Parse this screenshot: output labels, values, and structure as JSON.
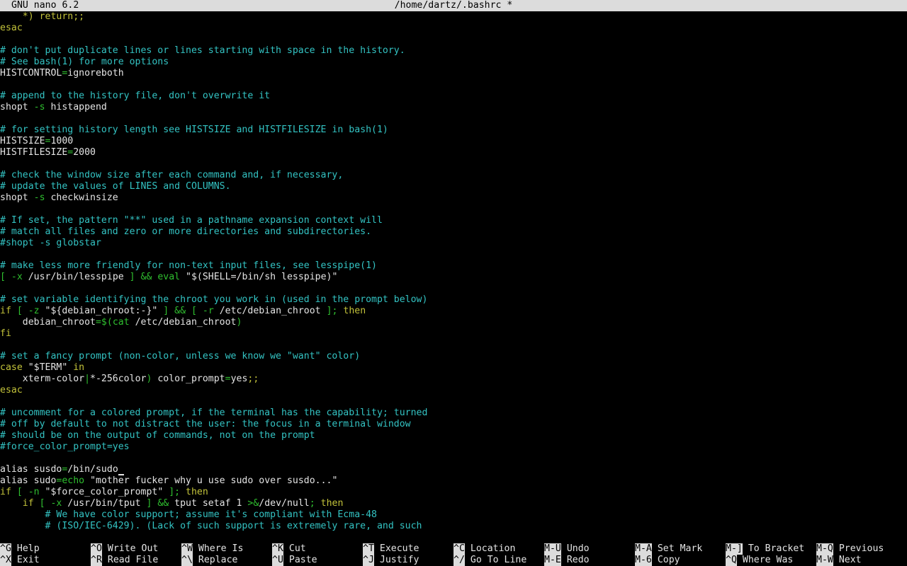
{
  "titlebar": {
    "app": "GNU nano 6.2",
    "filename": "/home/dartz/.bashrc *"
  },
  "colors": {
    "titlebar_bg": "#dcdcdc",
    "comment": "#33c3c3",
    "keyword": "#c2c23a",
    "operator": "#2fbf2f",
    "text": "#e4e4e4"
  },
  "lines": [
    [
      {
        "t": "    *) return;;",
        "c": "kw"
      }
    ],
    [
      {
        "t": "esac",
        "c": "kw"
      }
    ],
    [],
    [
      {
        "t": "# don't put duplicate lines or lines starting with space in the history.",
        "c": "cm"
      }
    ],
    [
      {
        "t": "# See bash(1) for more options",
        "c": "cm"
      }
    ],
    [
      {
        "t": "HISTCONTROL",
        "c": "var"
      },
      {
        "t": "=",
        "c": "op"
      },
      {
        "t": "ignoreboth",
        "c": "var"
      }
    ],
    [],
    [
      {
        "t": "# append to the history file, don't overwrite it",
        "c": "cm"
      }
    ],
    [
      {
        "t": "shopt ",
        "c": "var"
      },
      {
        "t": "-s",
        "c": "op"
      },
      {
        "t": " histappend",
        "c": "var"
      }
    ],
    [],
    [
      {
        "t": "# for setting history length see HISTSIZE and HISTFILESIZE in bash(1)",
        "c": "cm"
      }
    ],
    [
      {
        "t": "HISTSIZE",
        "c": "var"
      },
      {
        "t": "=",
        "c": "op"
      },
      {
        "t": "1000",
        "c": "var"
      }
    ],
    [
      {
        "t": "HISTFILESIZE",
        "c": "var"
      },
      {
        "t": "=",
        "c": "op"
      },
      {
        "t": "2000",
        "c": "var"
      }
    ],
    [],
    [
      {
        "t": "# check the window size after each command and, if necessary,",
        "c": "cm"
      }
    ],
    [
      {
        "t": "# update the values of LINES and COLUMNS.",
        "c": "cm"
      }
    ],
    [
      {
        "t": "shopt ",
        "c": "var"
      },
      {
        "t": "-s",
        "c": "op"
      },
      {
        "t": " checkwinsize",
        "c": "var"
      }
    ],
    [],
    [
      {
        "t": "# If set, the pattern \"**\" used in a pathname expansion context will",
        "c": "cm"
      }
    ],
    [
      {
        "t": "# match all files and zero or more directories and subdirectories.",
        "c": "cm"
      }
    ],
    [
      {
        "t": "#shopt -s globstar",
        "c": "cm"
      }
    ],
    [],
    [
      {
        "t": "# make less more friendly for non-text input files, see lesspipe(1)",
        "c": "cm"
      }
    ],
    [
      {
        "t": "[ ",
        "c": "op"
      },
      {
        "t": "-x",
        "c": "op"
      },
      {
        "t": " /usr/bin/lesspipe ",
        "c": "var"
      },
      {
        "t": "] && ",
        "c": "op"
      },
      {
        "t": "eval",
        "c": "op"
      },
      {
        "t": " \"$(SHELL=/bin/sh lesspipe)\"",
        "c": "str"
      }
    ],
    [],
    [
      {
        "t": "# set variable identifying the chroot you work in (used in the prompt below)",
        "c": "cm"
      }
    ],
    [
      {
        "t": "if",
        "c": "kw"
      },
      {
        "t": " [ ",
        "c": "op"
      },
      {
        "t": "-z",
        "c": "op"
      },
      {
        "t": " \"${debian_chroot:-}\"",
        "c": "str"
      },
      {
        "t": " ] && [ ",
        "c": "op"
      },
      {
        "t": "-r",
        "c": "op"
      },
      {
        "t": " /etc/debian_chroot ",
        "c": "var"
      },
      {
        "t": "]; ",
        "c": "op"
      },
      {
        "t": "then",
        "c": "kw"
      }
    ],
    [
      {
        "t": "    debian_chroot",
        "c": "var"
      },
      {
        "t": "=$(",
        "c": "op"
      },
      {
        "t": "cat",
        "c": "op"
      },
      {
        "t": " /etc/debian_chroot",
        "c": "var"
      },
      {
        "t": ")",
        "c": "op"
      }
    ],
    [
      {
        "t": "fi",
        "c": "kw"
      }
    ],
    [],
    [
      {
        "t": "# set a fancy prompt (non-color, unless we know we \"want\" color)",
        "c": "cm"
      }
    ],
    [
      {
        "t": "case",
        "c": "kw"
      },
      {
        "t": " \"$TERM\"",
        "c": "str"
      },
      {
        "t": " in",
        "c": "kw"
      }
    ],
    [
      {
        "t": "    xterm-color",
        "c": "var"
      },
      {
        "t": "|",
        "c": "op"
      },
      {
        "t": "*-256color",
        "c": "var"
      },
      {
        "t": ")",
        "c": "op"
      },
      {
        "t": " color_prompt",
        "c": "var"
      },
      {
        "t": "=",
        "c": "op"
      },
      {
        "t": "yes",
        "c": "var"
      },
      {
        "t": ";;",
        "c": "kw"
      }
    ],
    [
      {
        "t": "esac",
        "c": "kw"
      }
    ],
    [],
    [
      {
        "t": "# uncomment for a colored prompt, if the terminal has the capability; turned",
        "c": "cm"
      }
    ],
    [
      {
        "t": "# off by default to not distract the user: the focus in a terminal window",
        "c": "cm"
      }
    ],
    [
      {
        "t": "# should be on the output of commands, not on the prompt",
        "c": "cm"
      }
    ],
    [
      {
        "t": "#force_color_prompt=yes",
        "c": "cm"
      }
    ],
    [],
    [
      {
        "t": "alias susdo",
        "c": "var"
      },
      {
        "t": "=",
        "c": "op"
      },
      {
        "t": "/bin/sudo",
        "c": "var"
      }
    ],
    [
      {
        "t": "alias sudo",
        "c": "var"
      },
      {
        "t": "=",
        "c": "op"
      },
      {
        "t": "echo",
        "c": "op"
      },
      {
        "t": " \"mother fucker why u use sudo over susdo...\"",
        "c": "str"
      }
    ],
    [
      {
        "t": "if",
        "c": "kw"
      },
      {
        "t": " [ ",
        "c": "op"
      },
      {
        "t": "-n",
        "c": "op"
      },
      {
        "t": " \"$force_color_prompt\"",
        "c": "str"
      },
      {
        "t": " ]; ",
        "c": "op"
      },
      {
        "t": "then",
        "c": "kw"
      }
    ],
    [
      {
        "t": "    if",
        "c": "kw"
      },
      {
        "t": " [ ",
        "c": "op"
      },
      {
        "t": "-x",
        "c": "op"
      },
      {
        "t": " /usr/bin/tput ",
        "c": "var"
      },
      {
        "t": "] && ",
        "c": "op"
      },
      {
        "t": "tput setaf 1 ",
        "c": "var"
      },
      {
        "t": ">&",
        "c": "op"
      },
      {
        "t": "/dev/null",
        "c": "var"
      },
      {
        "t": "; ",
        "c": "op"
      },
      {
        "t": "then",
        "c": "kw"
      }
    ],
    [
      {
        "t": "        # We have color support; assume it's compliant with Ecma-48",
        "c": "cm"
      }
    ],
    [
      {
        "t": "        # (ISO/IEC-6429). (Lack of such support is extremely rare, and such",
        "c": "cm"
      }
    ]
  ],
  "shortcuts": [
    {
      "key": "^G",
      "label": "Help"
    },
    {
      "key": "^X",
      "label": "Exit"
    },
    {
      "key": "^O",
      "label": "Write Out"
    },
    {
      "key": "^R",
      "label": "Read File"
    },
    {
      "key": "^W",
      "label": "Where Is"
    },
    {
      "key": "^\\",
      "label": "Replace"
    },
    {
      "key": "^K",
      "label": "Cut"
    },
    {
      "key": "^U",
      "label": "Paste"
    },
    {
      "key": "^T",
      "label": "Execute"
    },
    {
      "key": "^J",
      "label": "Justify"
    },
    {
      "key": "^C",
      "label": "Location"
    },
    {
      "key": "^/",
      "label": "Go To Line"
    },
    {
      "key": "M-U",
      "label": "Undo"
    },
    {
      "key": "M-E",
      "label": "Redo"
    },
    {
      "key": "M-A",
      "label": "Set Mark"
    },
    {
      "key": "M-6",
      "label": "Copy"
    },
    {
      "key": "M-]",
      "label": "To Bracket"
    },
    {
      "key": "^Q",
      "label": "Where Was"
    },
    {
      "key": "M-Q",
      "label": "Previous"
    },
    {
      "key": "M-W",
      "label": "Next"
    }
  ]
}
